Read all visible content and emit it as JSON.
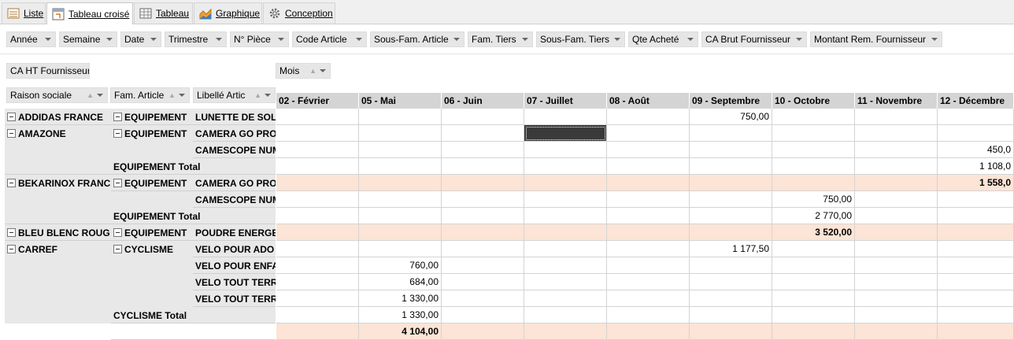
{
  "tabs": [
    {
      "label": "Liste",
      "icon": "list-icon"
    },
    {
      "label": "Tableau croisé",
      "icon": "pivot-table-icon",
      "active": true
    },
    {
      "label": "Tableau",
      "icon": "table-icon"
    },
    {
      "label": "Graphique",
      "icon": "chart-icon"
    },
    {
      "label": "Conception",
      "icon": "gear-icon"
    }
  ],
  "filter_fields": [
    "Année",
    "Semaine",
    "Date",
    "Trimestre",
    "N° Pièce",
    "Code Article",
    "Sous-Fam. Article",
    "Fam. Tiers",
    "Sous-Fam. Tiers",
    "Qte Acheté",
    "CA Brut Fournisseur",
    "Montant Rem. Fournisseur"
  ],
  "data_field": "CA HT Fournisseur",
  "column_field": "Mois",
  "row_fields": [
    "Raison sociale",
    "Fam. Article",
    "Libellé Artic"
  ],
  "columns": [
    "02 - Février",
    "05 - Mai",
    "06 - Juin",
    "07 - Juillet",
    "08 - Août",
    "09 - Septembre",
    "10 - Octobre",
    "11 - Novembre",
    "12 - Décembre"
  ],
  "groups": [
    {
      "name": "ADDIDAS FRANCE",
      "families": [
        {
          "name": "EQUIPEMENT",
          "items": [
            "LUNETTE DE SOLE"
          ]
        }
      ]
    },
    {
      "name": "AMAZONE",
      "families": [
        {
          "name": "EQUIPEMENT",
          "items": [
            "CAMERA GO PRO",
            "CAMESCOPE NUM"
          ],
          "total_label": "EQUIPEMENT Total"
        }
      ]
    },
    {
      "name": "BEKARINOX FRANCE",
      "families": [
        {
          "name": "EQUIPEMENT",
          "items": [
            "CAMERA GO PRO",
            "CAMESCOPE NUM"
          ],
          "total_label": "EQUIPEMENT Total"
        }
      ]
    },
    {
      "name": "BLEU BLENC ROUGE",
      "families": [
        {
          "name": "EQUIPEMENT",
          "items": [
            "POUDRE ENERGET"
          ]
        }
      ]
    },
    {
      "name": "CARREF",
      "families": [
        {
          "name": "CYCLISME",
          "items": [
            "VELO POUR ADO",
            "VELO POUR ENFAI",
            "VELO TOUT TERRA",
            "VELO TOUT TERRA"
          ],
          "total_label": "CYCLISME Total"
        }
      ]
    }
  ],
  "rows": [
    {
      "values": {
        "5": "750,00"
      }
    },
    {
      "values": {},
      "selected_col": 3
    },
    {
      "values": {
        "8": "450,0"
      }
    },
    {
      "values": {
        "8": "1 108,0"
      }
    },
    {
      "values": {
        "8": "1 558,0"
      },
      "total": true
    },
    {
      "values": {
        "6": "750,00"
      }
    },
    {
      "values": {
        "6": "2 770,00"
      }
    },
    {
      "values": {
        "6": "3 520,00"
      },
      "total": true
    },
    {
      "values": {
        "5": "1 177,50"
      }
    },
    {
      "values": {
        "1": "760,00"
      }
    },
    {
      "values": {
        "1": "684,00"
      }
    },
    {
      "values": {
        "1": "1 330,00"
      }
    },
    {
      "values": {
        "1": "1 330,00"
      }
    },
    {
      "values": {
        "1": "4 104,00"
      },
      "total": true
    }
  ],
  "colors": {
    "header": "#d4d4d4",
    "row_header": "#e8e8e8",
    "total_band": "#fce4d6",
    "selected": "#3a3a3a"
  }
}
